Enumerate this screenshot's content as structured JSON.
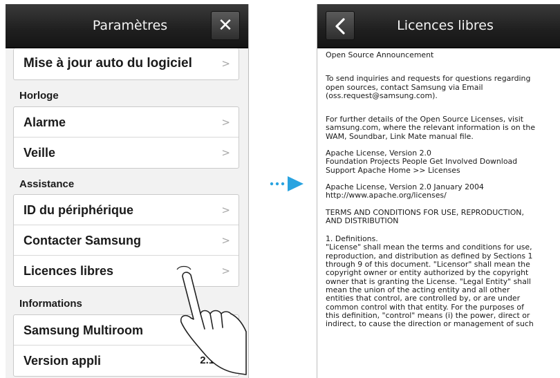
{
  "left": {
    "title": "Paramètres",
    "close_glyph": "✕",
    "top_item": "Mise à jour auto du logiciel",
    "sections": [
      {
        "label": "Horloge",
        "items": [
          {
            "label": "Alarme"
          },
          {
            "label": "Veille"
          }
        ]
      },
      {
        "label": "Assistance",
        "items": [
          {
            "label": "ID du périphérique"
          },
          {
            "label": "Contacter Samsung"
          },
          {
            "label": "Licences libres"
          }
        ]
      },
      {
        "label": "Informations",
        "items": [
          {
            "label": "Samsung Multiroom"
          },
          {
            "label": "Version appli",
            "value": "2.1.12"
          }
        ]
      }
    ],
    "chevron_glyph": ">"
  },
  "right": {
    "title": "Licences libres",
    "paragraphs": [
      "Open Source Announcement",
      "To send inquiries and requests for questions regarding\nopen sources, contact Samsung via Email\n(oss.request@samsung.com).",
      "For further details of the Open Source Licenses, visit\nsamsung.com, where the relevant information is on the\nWAM, Soundbar, Link Mate manual file.",
      "Apache License, Version 2.0\nFoundation Projects People Get Involved Download\nSupport Apache Home >> Licenses",
      "Apache License, Version 2.0 January 2004\nhttp://www.apache.org/licenses/",
      "TERMS AND CONDITIONS FOR USE, REPRODUCTION,\nAND DISTRIBUTION",
      "1. Definitions.\n\"License\" shall mean the terms and conditions for use,\nreproduction, and distribution as defined by Sections 1\nthrough 9 of this document. \"Licensor\" shall mean the\ncopyright owner or entity authorized by the copyright\nowner that is granting the License. \"Legal Entity\" shall\nmean the union of the acting entity and all other\nentities that control, are controlled by, or are under\ncommon control with that entity. For the purposes of\nthis definition, \"control\" means (i) the power, direct or\nindirect, to cause the direction or management of such"
    ]
  },
  "colors": {
    "topbar": "#1f1f1f",
    "arrow": "#29a3e0",
    "list_bg": "#f2f2f2"
  }
}
